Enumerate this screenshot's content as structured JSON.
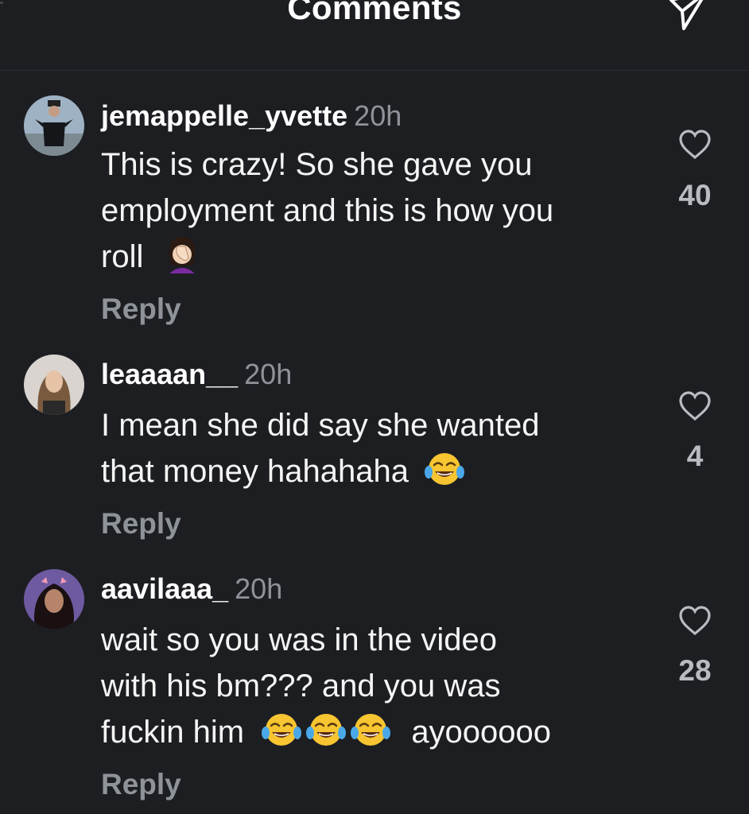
{
  "header": {
    "title": "Comments",
    "share_icon": "paper-plane-icon"
  },
  "comments": [
    {
      "username": "jemappelle_yvette",
      "time": "20h",
      "lines": [
        "This is crazy! So she gave you",
        "employment and this is how you",
        "roll"
      ],
      "emoji": "face-palm",
      "reply_label": "Reply",
      "likes": "40"
    },
    {
      "username": "leaaaan__",
      "time": "20h",
      "lines": [
        "I mean she did say she wanted",
        "that money hahahaha"
      ],
      "emoji": "tears-of-joy",
      "reply_label": "Reply",
      "likes": "4"
    },
    {
      "username": "aavilaaa_",
      "time": "20h",
      "lines": [
        "wait so you was in the video",
        "with his bm??? and you was",
        "fuckin him",
        "ayoooooo"
      ],
      "emoji": "tears-of-joy",
      "reply_label": "Reply",
      "likes": "28"
    }
  ],
  "colors": {
    "background": "#1c1e22",
    "text": "#f5f5f5",
    "muted": "#8e9299"
  }
}
